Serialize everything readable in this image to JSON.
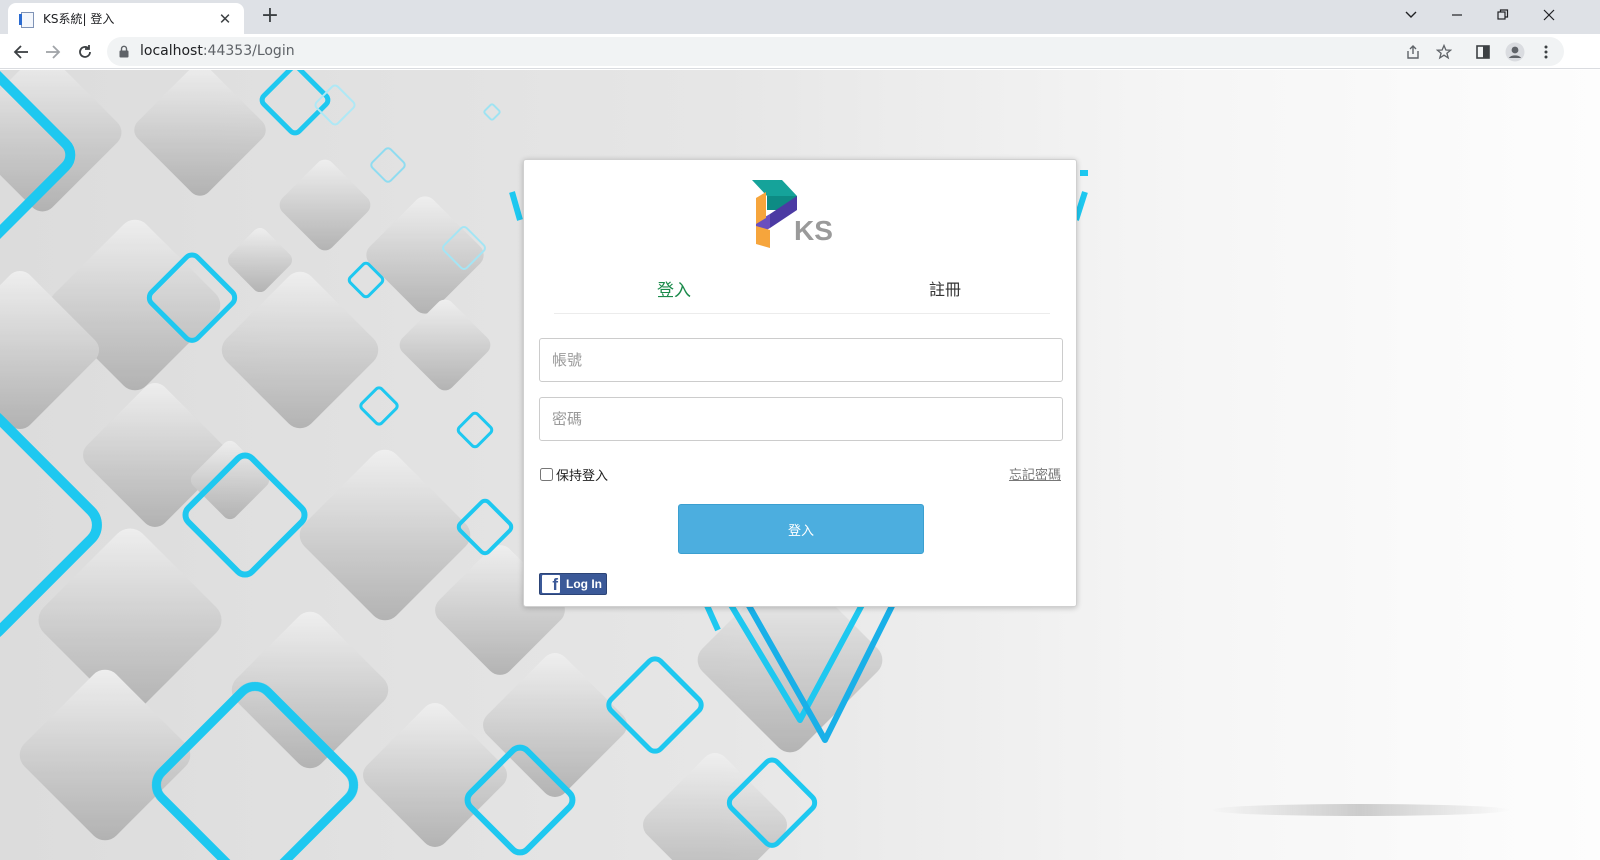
{
  "browser": {
    "tab_title": "KS系統| 登入",
    "url_host": "localhost",
    "url_rest": ":44353/Login"
  },
  "login": {
    "tabs": {
      "login": "登入",
      "register": "註冊"
    },
    "account_placeholder": "帳號",
    "password_placeholder": "密碼",
    "remember_label": "保持登入",
    "forgot_label": "忘記密碼",
    "submit_label": "登入",
    "facebook_label": "Log In"
  },
  "logo": {
    "text": "KS"
  },
  "colors": {
    "login_tab": "#1a8a4a",
    "submit_bg": "#4caedf",
    "facebook": "#3b5998",
    "accent_cyan": "#1ec8f0"
  }
}
